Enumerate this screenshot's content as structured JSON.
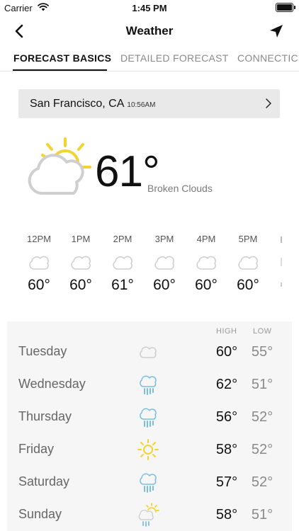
{
  "status_bar": {
    "carrier": "Carrier",
    "time": "1:45 PM"
  },
  "nav": {
    "title": "Weather"
  },
  "tabs": [
    {
      "label": "FORECAST BASICS",
      "active": true
    },
    {
      "label": "DETAILED FORECAST",
      "active": false
    },
    {
      "label": "CONNECTICU",
      "active": false
    }
  ],
  "location": {
    "city": "San Francisco, CA",
    "time": "10:56AM"
  },
  "current": {
    "temp": "61°",
    "description": "Broken Clouds",
    "icon": "sun-behind-cloud-icon"
  },
  "hourly": [
    {
      "time": "12PM",
      "icon": "cloud-icon",
      "temp": "60°"
    },
    {
      "time": "1PM",
      "icon": "cloud-icon",
      "temp": "60°"
    },
    {
      "time": "2PM",
      "icon": "cloud-icon",
      "temp": "61°"
    },
    {
      "time": "3PM",
      "icon": "cloud-icon",
      "temp": "60°"
    },
    {
      "time": "4PM",
      "icon": "cloud-icon",
      "temp": "60°"
    },
    {
      "time": "5PM",
      "icon": "cloud-icon",
      "temp": "60°"
    }
  ],
  "daily": {
    "high_header": "HIGH",
    "low_header": "LOW",
    "days": [
      {
        "name": "Tuesday",
        "icon": "cloud-icon",
        "high": "60°",
        "low": "55°"
      },
      {
        "name": "Wednesday",
        "icon": "rain-cloud-icon",
        "high": "62°",
        "low": "51°"
      },
      {
        "name": "Thursday",
        "icon": "rain-cloud-icon",
        "high": "56°",
        "low": "52°"
      },
      {
        "name": "Friday",
        "icon": "sun-icon",
        "high": "58°",
        "low": "52°"
      },
      {
        "name": "Saturday",
        "icon": "rain-cloud-icon",
        "high": "57°",
        "low": "52°"
      },
      {
        "name": "Sunday",
        "icon": "sun-rain-cloud-icon",
        "high": "58°",
        "low": "51°"
      }
    ]
  },
  "colors": {
    "sun": "#f2d431",
    "rain": "#79bde3",
    "cloud": "#cfcfcf",
    "card": "#e9e9e9",
    "panel": "#f6f6f6"
  }
}
